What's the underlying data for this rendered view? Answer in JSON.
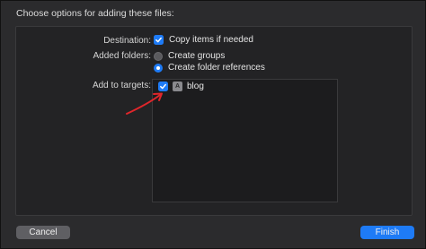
{
  "dialog": {
    "title": "Choose options for adding these files:"
  },
  "destination": {
    "label": "Destination:",
    "option_label": "Copy items if needed",
    "checked": true
  },
  "added_folders": {
    "label": "Added folders:",
    "options": [
      {
        "label": "Create groups",
        "selected": false
      },
      {
        "label": "Create folder references",
        "selected": true
      }
    ]
  },
  "targets": {
    "label": "Add to targets:",
    "items": [
      {
        "name": "blog",
        "checked": true,
        "icon": "app-target-icon"
      }
    ]
  },
  "buttons": {
    "cancel_label": "Cancel",
    "finish_label": "Finish"
  },
  "colors": {
    "accent": "#1e7bf6",
    "annotation": "#e0262b"
  }
}
